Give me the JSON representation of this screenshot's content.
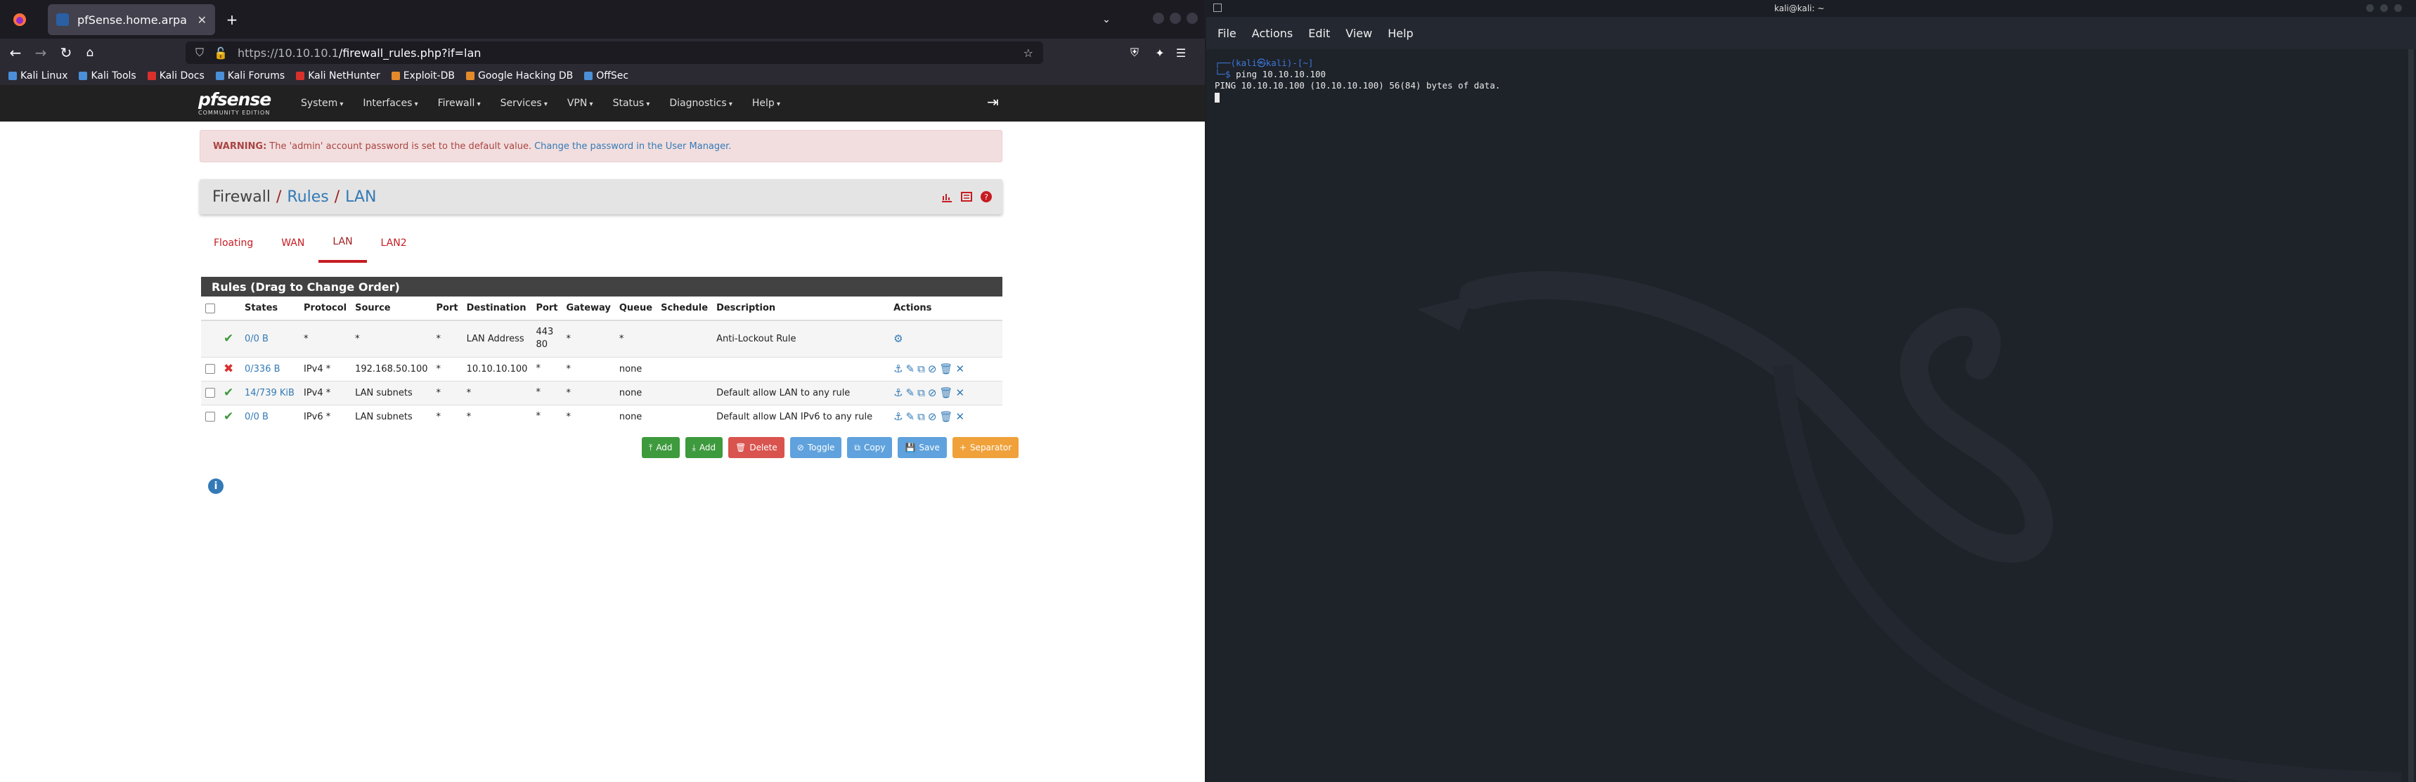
{
  "browser": {
    "tab_title": "pfSense.home.arpa - Fire",
    "url_host": "https://10.10.10.1",
    "url_path": "/firewall_rules.php?if=lan",
    "bookmarks": [
      {
        "label": "Kali Linux",
        "color": "#4a8fd8"
      },
      {
        "label": "Kali Tools",
        "color": "#4a8fd8"
      },
      {
        "label": "Kali Docs",
        "color": "#d9302c"
      },
      {
        "label": "Kali Forums",
        "color": "#4a8fd8"
      },
      {
        "label": "Kali NetHunter",
        "color": "#d9302c"
      },
      {
        "label": "Exploit-DB",
        "color": "#e58a2a"
      },
      {
        "label": "Google Hacking DB",
        "color": "#e58a2a"
      },
      {
        "label": "OffSec",
        "color": "#4a8fd8"
      }
    ]
  },
  "pfsense": {
    "logo_main": "pfsense",
    "logo_sub": "COMMUNITY EDITION",
    "menu": [
      "System",
      "Interfaces",
      "Firewall",
      "Services",
      "VPN",
      "Status",
      "Diagnostics",
      "Help"
    ],
    "warning_label": "WARNING:",
    "warning_text": "The 'admin' account password is set to the default value.",
    "warning_link": "Change the password in the User Manager.",
    "breadcrumb": {
      "c0": "Firewall",
      "c1": "Rules",
      "c2": "LAN",
      "sep": "/"
    },
    "tabs": [
      "Floating",
      "WAN",
      "LAN",
      "LAN2"
    ],
    "active_tab": "LAN",
    "panel_title": "Rules (Drag to Change Order)",
    "columns": [
      "States",
      "Protocol",
      "Source",
      "Port",
      "Destination",
      "Port",
      "Gateway",
      "Queue",
      "Schedule",
      "Description",
      "Actions"
    ],
    "rows": [
      {
        "status": "pass",
        "states": "0/0 B",
        "protocol": "*",
        "source": "*",
        "sport": "*",
        "destination": "LAN Address",
        "dport": "443 80",
        "gateway": "*",
        "queue": "*",
        "schedule": "",
        "description": "Anti-Lockout Rule"
      },
      {
        "status": "block",
        "states": "0/336 B",
        "protocol": "IPv4 *",
        "source": "192.168.50.100",
        "sport": "*",
        "destination": "10.10.10.100",
        "dport": "*",
        "gateway": "*",
        "queue": "none",
        "schedule": "",
        "description": ""
      },
      {
        "status": "pass",
        "states": "14/739 KiB",
        "protocol": "IPv4 *",
        "source": "LAN subnets",
        "sport": "*",
        "destination": "*",
        "dport": "*",
        "gateway": "*",
        "queue": "none",
        "schedule": "",
        "description": "Default allow LAN to any rule"
      },
      {
        "status": "pass",
        "states": "0/0 B",
        "protocol": "IPv6 *",
        "source": "LAN subnets",
        "sport": "*",
        "destination": "*",
        "dport": "*",
        "gateway": "*",
        "queue": "none",
        "schedule": "",
        "description": "Default allow LAN IPv6 to any rule"
      }
    ],
    "buttons": [
      {
        "label": "Add",
        "cls": "bg",
        "icon": "⤒"
      },
      {
        "label": "Add",
        "cls": "bg",
        "icon": "⤓"
      },
      {
        "label": "Delete",
        "cls": "br",
        "icon": "🗑"
      },
      {
        "label": "Toggle",
        "cls": "bb",
        "icon": "⊘"
      },
      {
        "label": "Copy",
        "cls": "bb",
        "icon": "⧉"
      },
      {
        "label": "Save",
        "cls": "bb",
        "icon": "💾"
      },
      {
        "label": "Separator",
        "cls": "bo",
        "icon": "+"
      }
    ]
  },
  "terminal": {
    "title": "kali@kali: ~",
    "menu": [
      "File",
      "Actions",
      "Edit",
      "View",
      "Help"
    ],
    "prompt_line1": "┌──(kali㉿kali)-[~]",
    "prompt_line2": "└─$ ",
    "command": "ping 10.10.10.100",
    "output": "PING 10.10.10.100 (10.10.10.100) 56(84) bytes of data."
  }
}
